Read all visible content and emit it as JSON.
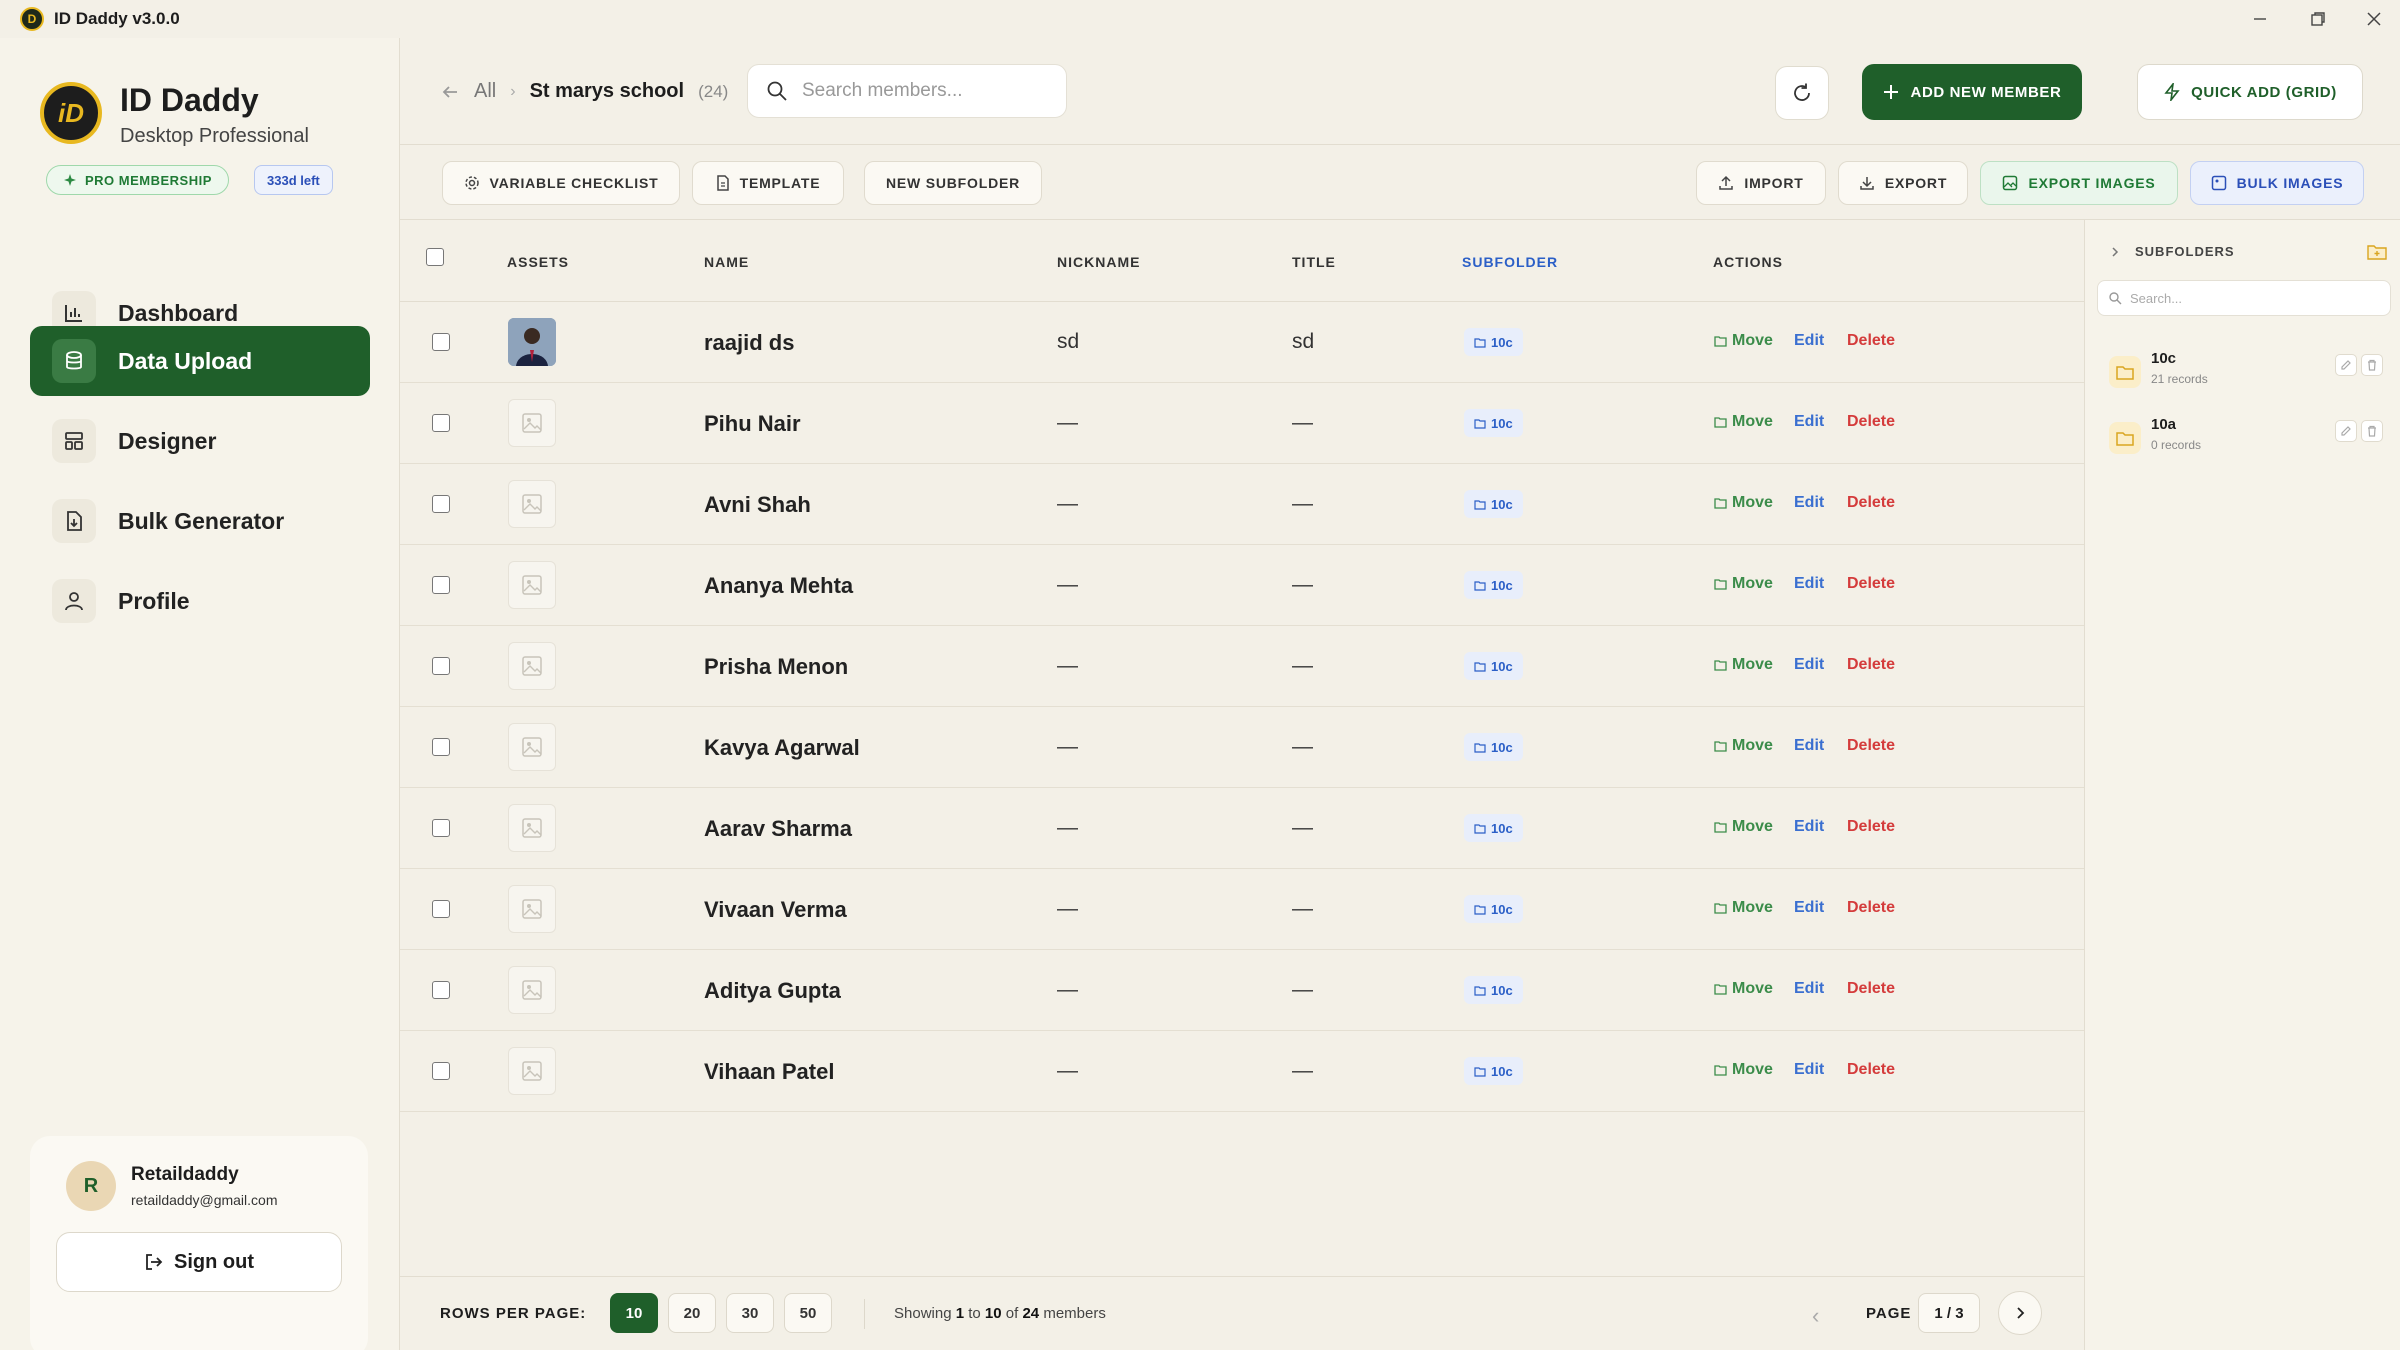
{
  "window": {
    "title": "ID Daddy v3.0.0",
    "logo_letter": "D"
  },
  "sidebar": {
    "brand_name": "ID Daddy",
    "brand_sub": "Desktop Professional",
    "brand_logo_letter": "iD",
    "membership": "PRO MEMBERSHIP",
    "days_left": "333d left",
    "nav": [
      {
        "label": "Dashboard",
        "icon": "bar-chart-icon",
        "active": false
      },
      {
        "label": "Data Upload",
        "icon": "database-icon",
        "active": true
      },
      {
        "label": "Designer",
        "icon": "layout-icon",
        "active": false
      },
      {
        "label": "Bulk Generator",
        "icon": "file-download-icon",
        "active": false
      },
      {
        "label": "Profile",
        "icon": "user-icon",
        "active": false
      }
    ],
    "user": {
      "initial": "R",
      "name": "Retaildaddy",
      "email": "retaildaddy@gmail.com",
      "signout_label": "Sign out"
    }
  },
  "header": {
    "crumb_all": "All",
    "crumb_current": "St marys school",
    "crumb_count": "(24)",
    "search_placeholder": "Search members...",
    "add_label": "ADD NEW MEMBER",
    "quick_label": "QUICK ADD (GRID)"
  },
  "toolbar": {
    "variable_checklist": "VARIABLE CHECKLIST",
    "template": "TEMPLATE",
    "new_subfolder": "NEW SUBFOLDER",
    "import": "IMPORT",
    "export": "EXPORT",
    "export_images": "EXPORT IMAGES",
    "bulk_images": "BULK IMAGES"
  },
  "table": {
    "columns": {
      "assets": "ASSETS",
      "name": "NAME",
      "nickname": "NICKNAME",
      "title": "TITLE",
      "subfolder": "SUBFOLDER",
      "actions": "ACTIONS"
    },
    "action_labels": {
      "move": "Move",
      "edit": "Edit",
      "delete": "Delete"
    },
    "rows": [
      {
        "name": "raajid ds",
        "nickname": "sd",
        "title": "sd",
        "subfolder": "10c",
        "has_photo": true
      },
      {
        "name": "Pihu Nair",
        "nickname": "—",
        "title": "—",
        "subfolder": "10c",
        "has_photo": false
      },
      {
        "name": "Avni Shah",
        "nickname": "—",
        "title": "—",
        "subfolder": "10c",
        "has_photo": false
      },
      {
        "name": "Ananya Mehta",
        "nickname": "—",
        "title": "—",
        "subfolder": "10c",
        "has_photo": false
      },
      {
        "name": "Prisha Menon",
        "nickname": "—",
        "title": "—",
        "subfolder": "10c",
        "has_photo": false
      },
      {
        "name": "Kavya Agarwal",
        "nickname": "—",
        "title": "—",
        "subfolder": "10c",
        "has_photo": false
      },
      {
        "name": "Aarav Sharma",
        "nickname": "—",
        "title": "—",
        "subfolder": "10c",
        "has_photo": false
      },
      {
        "name": "Vivaan Verma",
        "nickname": "—",
        "title": "—",
        "subfolder": "10c",
        "has_photo": false
      },
      {
        "name": "Aditya Gupta",
        "nickname": "—",
        "title": "—",
        "subfolder": "10c",
        "has_photo": false
      },
      {
        "name": "Vihaan Patel",
        "nickname": "—",
        "title": "—",
        "subfolder": "10c",
        "has_photo": false
      }
    ]
  },
  "pagination": {
    "rows_per_page_label": "ROWS PER PAGE:",
    "options": [
      "10",
      "20",
      "30",
      "50"
    ],
    "selected": "10",
    "showing_prefix": "Showing",
    "showing_from": "1",
    "showing_to_word": "to",
    "showing_to": "10",
    "showing_of_word": "of",
    "showing_total": "24",
    "showing_suffix": "members",
    "page_label": "PAGE",
    "page_value": "1 / 3"
  },
  "subfolders": {
    "title": "SUBFOLDERS",
    "search_placeholder": "Search...",
    "items": [
      {
        "name": "10c",
        "count": "21 records"
      },
      {
        "name": "10a",
        "count": "0 records"
      }
    ]
  },
  "colors": {
    "primary_green": "#1f5f2a",
    "link_blue": "#3a6fd0",
    "delete_red": "#d43b3b",
    "gold": "#e8b820"
  }
}
